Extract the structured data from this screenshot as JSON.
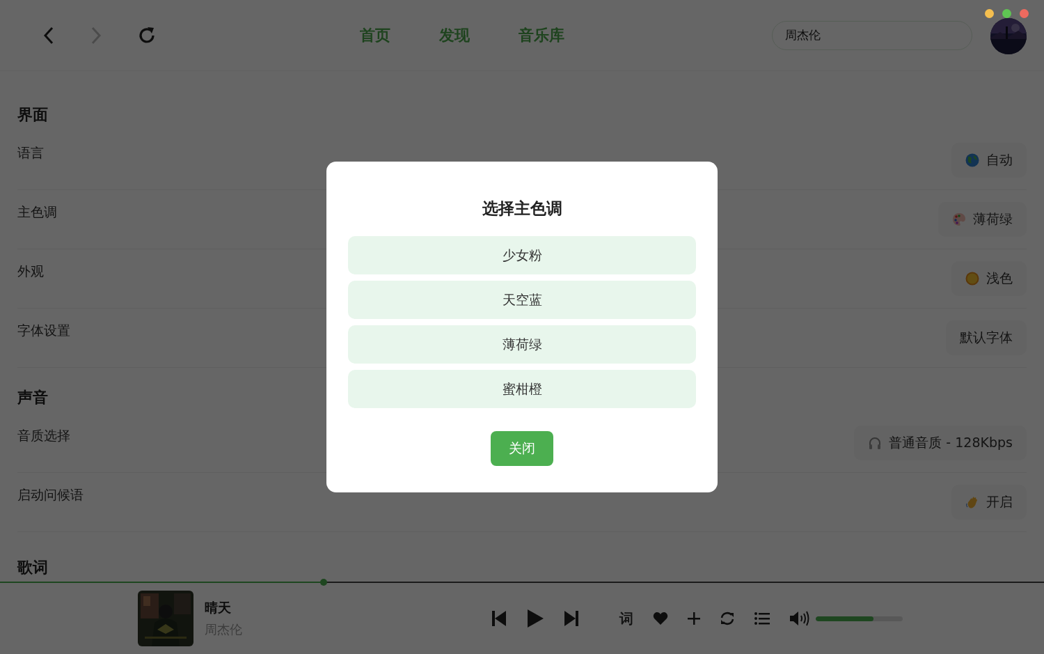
{
  "window_controls": [
    {
      "color": "#f5bf4f"
    },
    {
      "color": "#5fc553"
    },
    {
      "color": "#ee6a5f"
    }
  ],
  "nav": {
    "back": {
      "disabled": false
    },
    "forward": {
      "disabled": true
    }
  },
  "tabs": [
    {
      "label": "首页"
    },
    {
      "label": "发现"
    },
    {
      "label": "音乐库"
    }
  ],
  "search": {
    "value": "周杰伦"
  },
  "sections": [
    {
      "title": "界面",
      "rows": [
        {
          "label": "语言",
          "value": "自动",
          "kind": "globe"
        },
        {
          "label": "主色调",
          "value": "薄荷绿",
          "kind": "palette"
        },
        {
          "label": "外观",
          "value": "浅色",
          "kind": "sun"
        },
        {
          "label": "字体设置",
          "value": "默认字体",
          "kind": "plain"
        }
      ]
    },
    {
      "title": "声音",
      "rows": [
        {
          "label": "音质选择",
          "value": "普通音质 - 128Kbps",
          "kind": "headphones"
        },
        {
          "label": "启动问候语",
          "value": "开启",
          "kind": "wave"
        }
      ]
    },
    {
      "title": "歌词"
    }
  ],
  "dialog": {
    "title": "选择主色调",
    "options": [
      "少女粉",
      "天空蓝",
      "薄荷绿",
      "蜜柑橙"
    ],
    "close": "关闭"
  },
  "player": {
    "progress": {
      "level": 0.31
    },
    "title": "晴天",
    "artist": "周杰伦",
    "lyrics_button": "词",
    "liked": true,
    "volume": {
      "level": 0.66
    }
  }
}
